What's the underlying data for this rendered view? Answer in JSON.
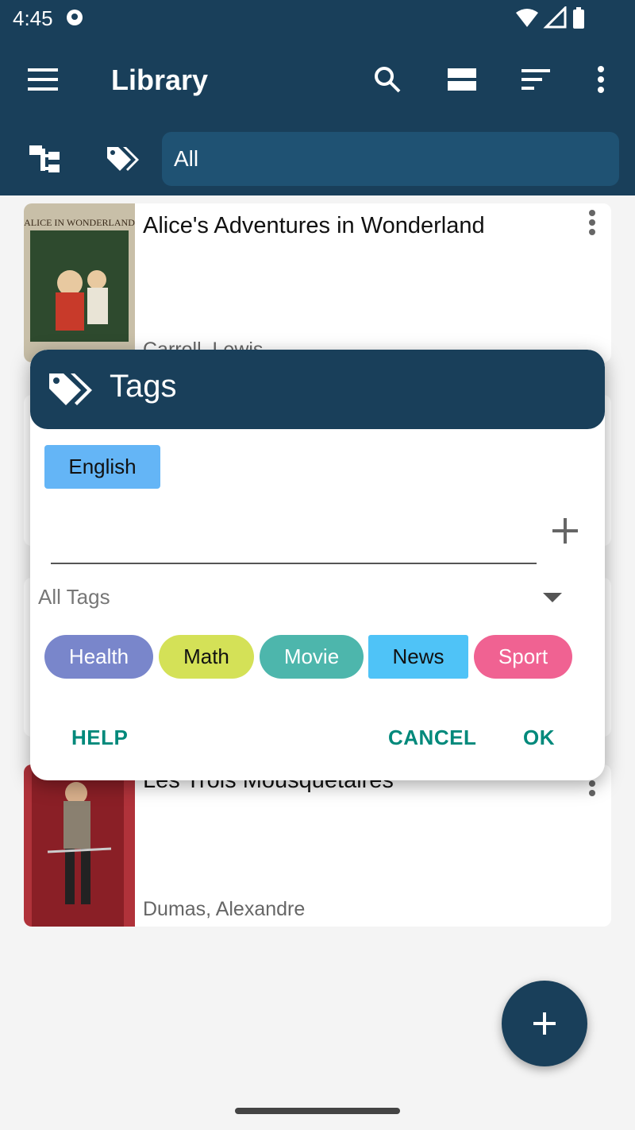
{
  "status_bar": {
    "time": "4:45"
  },
  "app_bar": {
    "title": "Library",
    "filter_value": "All"
  },
  "books": [
    {
      "title": "Alice's Adventures in Wonderland",
      "author": "Carroll, Lewis",
      "cover_text": "ALICE IN WONDERLAND"
    },
    {
      "title": "Les Trois Mousquetaires",
      "author": "Dumas, Alexandre"
    }
  ],
  "dialog": {
    "title": "Tags",
    "selected_tags": [
      "English"
    ],
    "input_value": "",
    "all_tags_label": "All Tags",
    "tags": [
      {
        "label": "Health",
        "color": "#7986cb",
        "text_color": "#ffffff"
      },
      {
        "label": "Math",
        "color": "#d4e157",
        "text_color": "#111111"
      },
      {
        "label": "Movie",
        "color": "#4db6ac",
        "text_color": "#ffffff"
      },
      {
        "label": "News",
        "color": "#4fc3f7",
        "text_color": "#111111"
      },
      {
        "label": "Sport",
        "color": "#f06292",
        "text_color": "#ffffff"
      }
    ],
    "buttons": {
      "help": "HELP",
      "cancel": "CANCEL",
      "ok": "OK"
    }
  },
  "colors": {
    "primary": "#193f5a",
    "accent": "#00897b",
    "selected_tag": "#64b5f6"
  }
}
